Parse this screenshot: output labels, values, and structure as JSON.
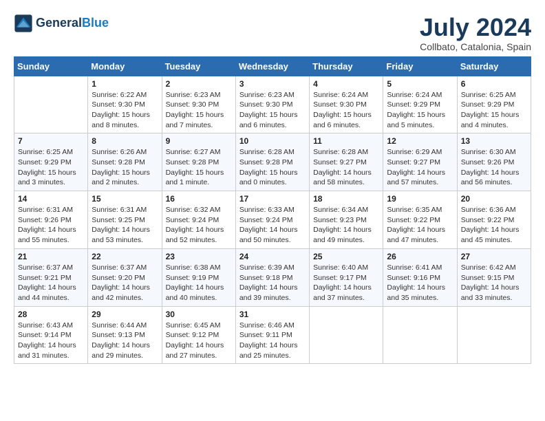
{
  "header": {
    "logo_line1": "General",
    "logo_line2": "Blue",
    "month_title": "July 2024",
    "location": "Collbato, Catalonia, Spain"
  },
  "days_of_week": [
    "Sunday",
    "Monday",
    "Tuesday",
    "Wednesday",
    "Thursday",
    "Friday",
    "Saturday"
  ],
  "weeks": [
    [
      {
        "day": "",
        "info": ""
      },
      {
        "day": "1",
        "info": "Sunrise: 6:22 AM\nSunset: 9:30 PM\nDaylight: 15 hours\nand 8 minutes."
      },
      {
        "day": "2",
        "info": "Sunrise: 6:23 AM\nSunset: 9:30 PM\nDaylight: 15 hours\nand 7 minutes."
      },
      {
        "day": "3",
        "info": "Sunrise: 6:23 AM\nSunset: 9:30 PM\nDaylight: 15 hours\nand 6 minutes."
      },
      {
        "day": "4",
        "info": "Sunrise: 6:24 AM\nSunset: 9:30 PM\nDaylight: 15 hours\nand 6 minutes."
      },
      {
        "day": "5",
        "info": "Sunrise: 6:24 AM\nSunset: 9:29 PM\nDaylight: 15 hours\nand 5 minutes."
      },
      {
        "day": "6",
        "info": "Sunrise: 6:25 AM\nSunset: 9:29 PM\nDaylight: 15 hours\nand 4 minutes."
      }
    ],
    [
      {
        "day": "7",
        "info": "Sunrise: 6:25 AM\nSunset: 9:29 PM\nDaylight: 15 hours\nand 3 minutes."
      },
      {
        "day": "8",
        "info": "Sunrise: 6:26 AM\nSunset: 9:28 PM\nDaylight: 15 hours\nand 2 minutes."
      },
      {
        "day": "9",
        "info": "Sunrise: 6:27 AM\nSunset: 9:28 PM\nDaylight: 15 hours\nand 1 minute."
      },
      {
        "day": "10",
        "info": "Sunrise: 6:28 AM\nSunset: 9:28 PM\nDaylight: 15 hours\nand 0 minutes."
      },
      {
        "day": "11",
        "info": "Sunrise: 6:28 AM\nSunset: 9:27 PM\nDaylight: 14 hours\nand 58 minutes."
      },
      {
        "day": "12",
        "info": "Sunrise: 6:29 AM\nSunset: 9:27 PM\nDaylight: 14 hours\nand 57 minutes."
      },
      {
        "day": "13",
        "info": "Sunrise: 6:30 AM\nSunset: 9:26 PM\nDaylight: 14 hours\nand 56 minutes."
      }
    ],
    [
      {
        "day": "14",
        "info": "Sunrise: 6:31 AM\nSunset: 9:26 PM\nDaylight: 14 hours\nand 55 minutes."
      },
      {
        "day": "15",
        "info": "Sunrise: 6:31 AM\nSunset: 9:25 PM\nDaylight: 14 hours\nand 53 minutes."
      },
      {
        "day": "16",
        "info": "Sunrise: 6:32 AM\nSunset: 9:24 PM\nDaylight: 14 hours\nand 52 minutes."
      },
      {
        "day": "17",
        "info": "Sunrise: 6:33 AM\nSunset: 9:24 PM\nDaylight: 14 hours\nand 50 minutes."
      },
      {
        "day": "18",
        "info": "Sunrise: 6:34 AM\nSunset: 9:23 PM\nDaylight: 14 hours\nand 49 minutes."
      },
      {
        "day": "19",
        "info": "Sunrise: 6:35 AM\nSunset: 9:22 PM\nDaylight: 14 hours\nand 47 minutes."
      },
      {
        "day": "20",
        "info": "Sunrise: 6:36 AM\nSunset: 9:22 PM\nDaylight: 14 hours\nand 45 minutes."
      }
    ],
    [
      {
        "day": "21",
        "info": "Sunrise: 6:37 AM\nSunset: 9:21 PM\nDaylight: 14 hours\nand 44 minutes."
      },
      {
        "day": "22",
        "info": "Sunrise: 6:37 AM\nSunset: 9:20 PM\nDaylight: 14 hours\nand 42 minutes."
      },
      {
        "day": "23",
        "info": "Sunrise: 6:38 AM\nSunset: 9:19 PM\nDaylight: 14 hours\nand 40 minutes."
      },
      {
        "day": "24",
        "info": "Sunrise: 6:39 AM\nSunset: 9:18 PM\nDaylight: 14 hours\nand 39 minutes."
      },
      {
        "day": "25",
        "info": "Sunrise: 6:40 AM\nSunset: 9:17 PM\nDaylight: 14 hours\nand 37 minutes."
      },
      {
        "day": "26",
        "info": "Sunrise: 6:41 AM\nSunset: 9:16 PM\nDaylight: 14 hours\nand 35 minutes."
      },
      {
        "day": "27",
        "info": "Sunrise: 6:42 AM\nSunset: 9:15 PM\nDaylight: 14 hours\nand 33 minutes."
      }
    ],
    [
      {
        "day": "28",
        "info": "Sunrise: 6:43 AM\nSunset: 9:14 PM\nDaylight: 14 hours\nand 31 minutes."
      },
      {
        "day": "29",
        "info": "Sunrise: 6:44 AM\nSunset: 9:13 PM\nDaylight: 14 hours\nand 29 minutes."
      },
      {
        "day": "30",
        "info": "Sunrise: 6:45 AM\nSunset: 9:12 PM\nDaylight: 14 hours\nand 27 minutes."
      },
      {
        "day": "31",
        "info": "Sunrise: 6:46 AM\nSunset: 9:11 PM\nDaylight: 14 hours\nand 25 minutes."
      },
      {
        "day": "",
        "info": ""
      },
      {
        "day": "",
        "info": ""
      },
      {
        "day": "",
        "info": ""
      }
    ]
  ]
}
